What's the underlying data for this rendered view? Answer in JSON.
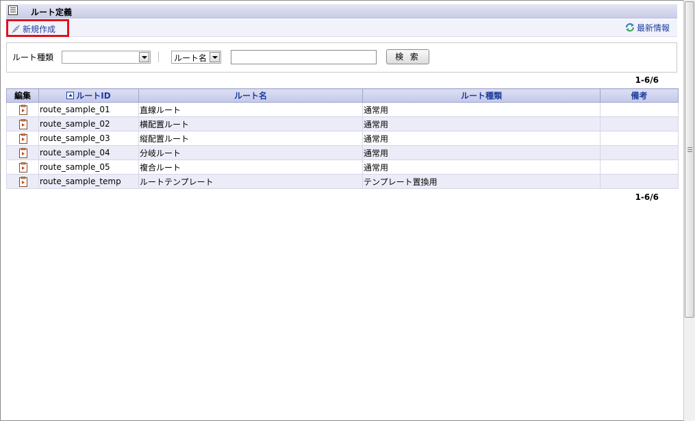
{
  "title": "ルート定義",
  "toolbar": {
    "new_label": "新規作成",
    "refresh_label": "最新情報"
  },
  "search": {
    "route_type_label": "ルート種類",
    "route_type_value": "",
    "field_select_value": "ルート名",
    "keyword_value": "",
    "search_button_label": "検 索"
  },
  "count_text": "1-6/6",
  "table": {
    "headers": [
      "編集",
      "ルートID",
      "ルート名",
      "ルート種類",
      "備考"
    ],
    "rows": [
      {
        "id": "route_sample_01",
        "name": "直線ルート",
        "type": "通常用",
        "note": ""
      },
      {
        "id": "route_sample_02",
        "name": "横配置ルート",
        "type": "通常用",
        "note": ""
      },
      {
        "id": "route_sample_03",
        "name": "縦配置ルート",
        "type": "通常用",
        "note": ""
      },
      {
        "id": "route_sample_04",
        "name": "分岐ルート",
        "type": "通常用",
        "note": ""
      },
      {
        "id": "route_sample_05",
        "name": "複合ルート",
        "type": "通常用",
        "note": ""
      },
      {
        "id": "route_sample_temp",
        "name": "ルートテンプレート",
        "type": "テンプレート置換用",
        "note": ""
      }
    ]
  },
  "colors": {
    "link": "#1c3c9c",
    "highlight_border": "#e0101a",
    "header_bg": "#c4c8ea",
    "row_alt_bg": "#ececf8"
  },
  "icons": {
    "title": "list-icon",
    "new": "feather-icon",
    "refresh": "refresh-icon",
    "edit": "edit-document-icon",
    "sort": "sort-ascending-icon"
  }
}
